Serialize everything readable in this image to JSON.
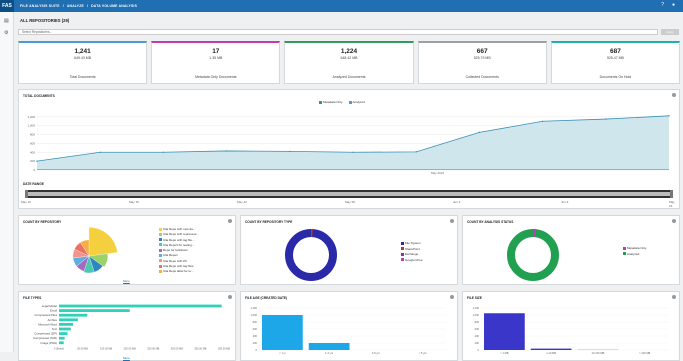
{
  "topbar": {
    "logo": "FAS",
    "crumbs": [
      "FILE ANALYSIS SUITE",
      "/",
      "ANALYZE",
      "/",
      "DATA VOLUME ANALYSIS"
    ],
    "help_icon": "help-icon",
    "user_icon": "user-icon"
  },
  "repositories": {
    "title": "ALL REPOSITORIES (29)",
    "placeholder": "Select Repositories...",
    "button": "Apply"
  },
  "kpis": [
    {
      "value": "1,241",
      "size": "649.43 MB",
      "label": "Total Documents",
      "color": "#4b9cd3"
    },
    {
      "value": "17",
      "size": "1.35 MB",
      "label": "Metadata Only Documents",
      "color": "#c239b3"
    },
    {
      "value": "1,224",
      "size": "648.42 MB",
      "label": "Analyzed Documents",
      "color": "#2e9e5b"
    },
    {
      "value": "667",
      "size": "525.79 MB",
      "label": "Collected Documents",
      "color": "#9aa0a6"
    },
    {
      "value": "687",
      "size": "525.47 MB",
      "label": "Documents On Hold",
      "color": "#20b2aa"
    }
  ],
  "total_documents": {
    "title": "TOTAL DOCUMENTS",
    "legend": [
      "Metadata Only",
      "Analyzed"
    ],
    "x_label": "May 2021"
  },
  "date_range": {
    "title": "DATE RANGE",
    "ticks": [
      "May 10",
      "May 16",
      "May 22",
      "May 28",
      "Jun 3",
      "Jun 9",
      "May 16"
    ]
  },
  "count_by_repository": {
    "title": "COUNT BY REPOSITORY",
    "more": "More",
    "items": [
      {
        "label": "Ulia Repo with new da...",
        "color": "#f4d03f"
      },
      {
        "label": "Ulia Repo with reprocess...",
        "color": "#9bd36a"
      },
      {
        "label": "Ulia Repo with tag file...",
        "color": "#2e86c1"
      },
      {
        "label": "Ulia Repo3 for testing...",
        "color": "#48c9b0"
      },
      {
        "label": "Repo for lockdown",
        "color": "#a569bd"
      },
      {
        "label": "Ulia Repo1",
        "color": "#5dade2"
      },
      {
        "label": "Ulia Repo with PII",
        "color": "#f1948a"
      },
      {
        "label": "Ulia Repo with tag files",
        "color": "#ec7063"
      },
      {
        "label": "Ulia Repo label for te...",
        "color": "#f5b041"
      }
    ]
  },
  "count_by_repository_type": {
    "title": "COUNT BY REPOSITORY TYPE",
    "items": [
      {
        "label": "File System",
        "color": "#2a2aa8"
      },
      {
        "label": "SharePoint",
        "color": "#c0392b"
      },
      {
        "label": "Exchange",
        "color": "#7d3c98"
      },
      {
        "label": "Google Drive",
        "color": "#c239b3"
      }
    ]
  },
  "count_by_analysis_status": {
    "title": "COUNT BY ANALYSIS STATUS",
    "items": [
      {
        "label": "Metadata Only",
        "color": "#c239b3"
      },
      {
        "label": "Analyzed",
        "color": "#22a052"
      }
    ]
  },
  "file_types": {
    "title": "FILE TYPES",
    "more": "More",
    "labels": [
      "Legal Model",
      "Email",
      "Compressed Files",
      "Archive",
      "Microsoft Word",
      "Text",
      "Compressed (ZIP)",
      "Compressed (TAR)",
      "Image (PNG)"
    ],
    "ticks": [
      "0 (Bytes)",
      "50.00 MB",
      "100.00 MB",
      "150.00 MB",
      "200.00 MB",
      "250.00 MB",
      "300.00 MB",
      "350.00 MB"
    ]
  },
  "file_age": {
    "title": "FILE AGE (CREATED DATE)",
    "ticks": [
      "< 1 yr",
      "1-3 yrs",
      "3-5 yrs",
      "> 5 yrs"
    ]
  },
  "file_size": {
    "title": "FILE SIZE",
    "ticks": [
      "< 1 MB",
      "1-10 MB",
      "10-100 MB",
      "> 100 MB"
    ]
  },
  "chart_data": [
    {
      "type": "area",
      "title": "TOTAL DOCUMENTS",
      "series": [
        {
          "name": "Metadata Only",
          "values": [
            17,
            17,
            17,
            17,
            17,
            17,
            17,
            17,
            17,
            17,
            17
          ]
        },
        {
          "name": "Analyzed",
          "values": [
            200,
            400,
            400,
            430,
            420,
            400,
            410,
            850,
            1100,
            1150,
            1224
          ]
        }
      ],
      "ylim": [
        0,
        1400
      ],
      "y_ticks": [
        0,
        200,
        400,
        600,
        800,
        1000,
        1200
      ]
    },
    {
      "type": "pie",
      "title": "COUNT BY REPOSITORY",
      "values": [
        23,
        12,
        10,
        10,
        9,
        9,
        9,
        9,
        9
      ]
    },
    {
      "type": "pie",
      "title": "COUNT BY REPOSITORY TYPE",
      "values": [
        99,
        0.3,
        0.3,
        0.4
      ]
    },
    {
      "type": "pie",
      "title": "COUNT BY ANALYSIS STATUS",
      "values": [
        1.4,
        98.6
      ]
    },
    {
      "type": "bar",
      "title": "FILE TYPES",
      "values": [
        345,
        150,
        60,
        40,
        30,
        25,
        18,
        12,
        10
      ]
    },
    {
      "type": "bar",
      "title": "FILE AGE (CREATED DATE)",
      "categories": [
        "< 1 yr",
        "1-3 yrs",
        "3-5 yrs",
        "> 5 yrs"
      ],
      "values": [
        1000,
        200,
        0,
        0
      ],
      "ylim": [
        0,
        1200
      ]
    },
    {
      "type": "bar",
      "title": "FILE SIZE",
      "categories": [
        "< 1 MB",
        "1-10 MB",
        "10-100 MB",
        "> 100 MB"
      ],
      "values": [
        1050,
        40,
        5,
        0
      ],
      "ylim": [
        0,
        1200
      ]
    }
  ]
}
